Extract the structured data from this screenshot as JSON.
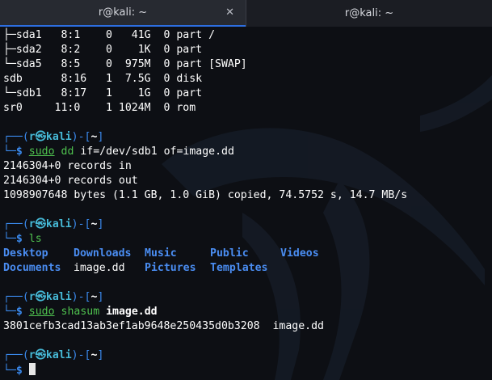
{
  "tabs": [
    {
      "title": "r@kali: ~",
      "close": "✕"
    },
    {
      "title": "r@kali: ~"
    }
  ],
  "lsblk_rows": [
    "├─sda1   8:1    0   41G  0 part /",
    "├─sda2   8:2    0    1K  0 part",
    "└─sda5   8:5    0  975M  0 part [SWAP]",
    "sdb      8:16   1  7.5G  0 disk",
    "└─sdb1   8:17   1    1G  0 part",
    "sr0     11:0    1 1024M  0 rom"
  ],
  "prompt": {
    "top_a": "┌──(",
    "user": "r",
    "at": "㉿",
    "host": "kali",
    "top_b": ")-[",
    "cwd": "~",
    "top_c": "]",
    "bottom": "└─",
    "dollar": "$"
  },
  "cmd1": {
    "sudo": "sudo",
    "prog": "dd",
    "args": "if=/dev/sdb1 of=image.dd"
  },
  "dd_output": [
    "2146304+0 records in",
    "2146304+0 records out",
    "1098907648 bytes (1.1 GB, 1.0 GiB) copied, 74.5752 s, 14.7 MB/s"
  ],
  "cmd2": {
    "prog": "ls"
  },
  "ls_output": {
    "row1": [
      "Desktop",
      "Downloads",
      "Music",
      "Public",
      "Videos"
    ],
    "row2": [
      "Documents",
      "image.dd",
      "Pictures",
      "Templates"
    ]
  },
  "cmd3": {
    "sudo": "sudo",
    "prog": "shasum",
    "arg": "image.dd"
  },
  "shasum_output": "3801cefb3cad13ab3ef1ab9648e250435d0b3208  image.dd",
  "colors": {
    "prompt_frame": "#3b8bf0",
    "host": "#46b9d6",
    "command": "#4fc24f",
    "directory": "#4a8df2"
  }
}
